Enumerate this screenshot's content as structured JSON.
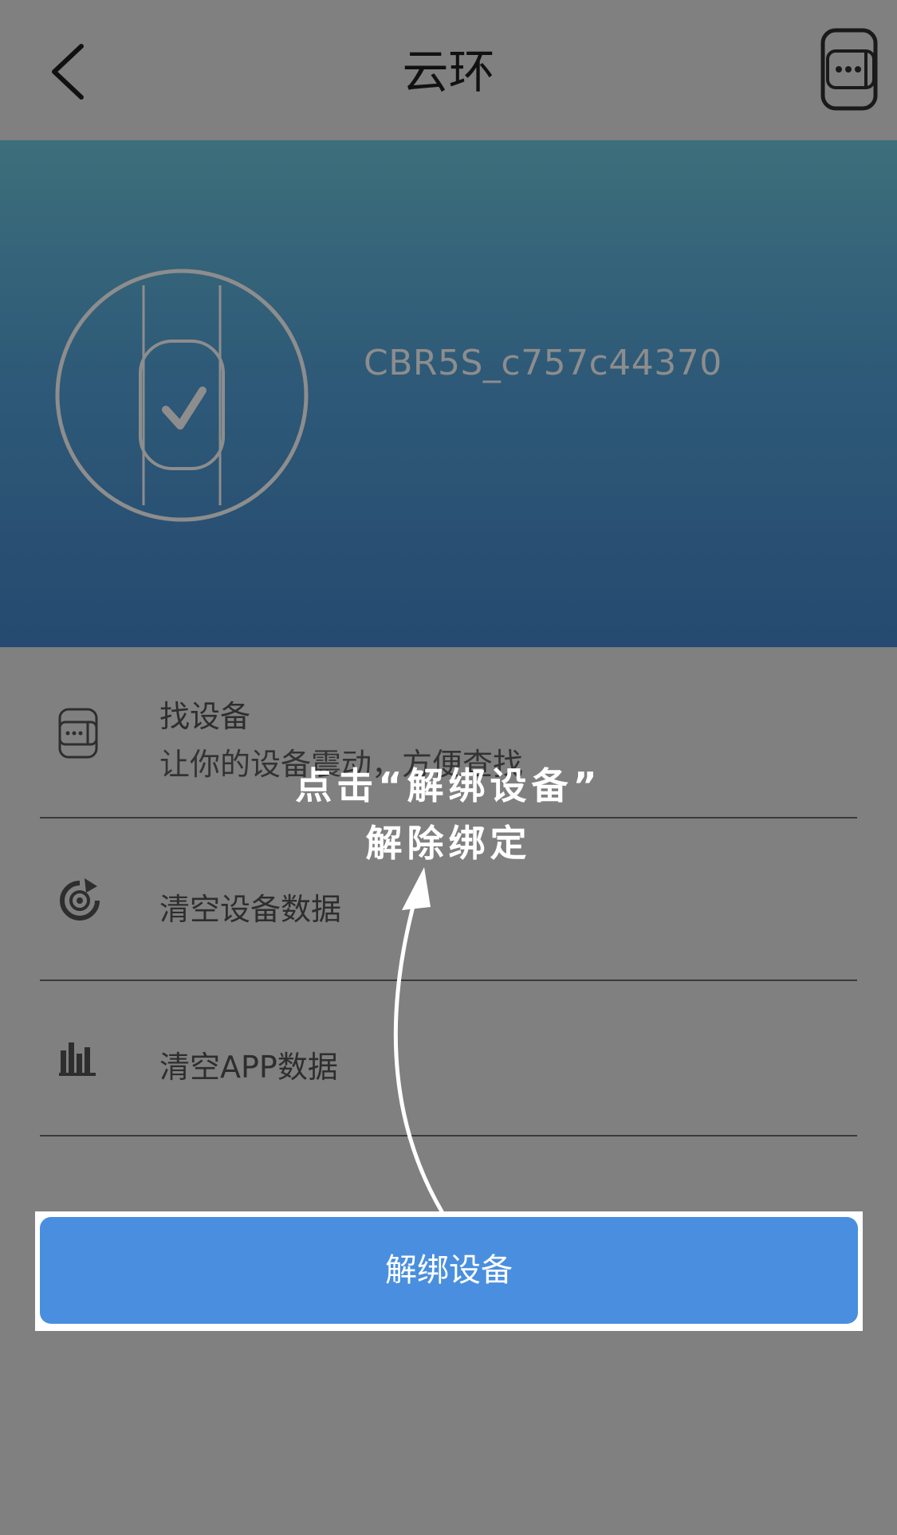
{
  "nav": {
    "title": "云环",
    "back_icon": "chevron-left-icon",
    "band_icon": "band-more-icon"
  },
  "device": {
    "name": "CBR5S_c757c44370",
    "icon": "band-connected-check-icon"
  },
  "menu": [
    {
      "label": "找设备",
      "sub": "让你的设备震动，方便查找",
      "icon": "band-find-icon"
    },
    {
      "label": "清空设备数据",
      "icon": "clear-refresh-icon"
    },
    {
      "label": "清空APP数据",
      "icon": "bar-chart-icon"
    }
  ],
  "unbind_button": "解绑设备",
  "overlay": {
    "line1": "点击“解绑设备”",
    "line2": "解除绑定"
  },
  "colors": {
    "accent": "#4a8fdf",
    "overlay_bg": "#808080",
    "hero_top": "#3c6f7b",
    "hero_bottom": "#264a70"
  }
}
